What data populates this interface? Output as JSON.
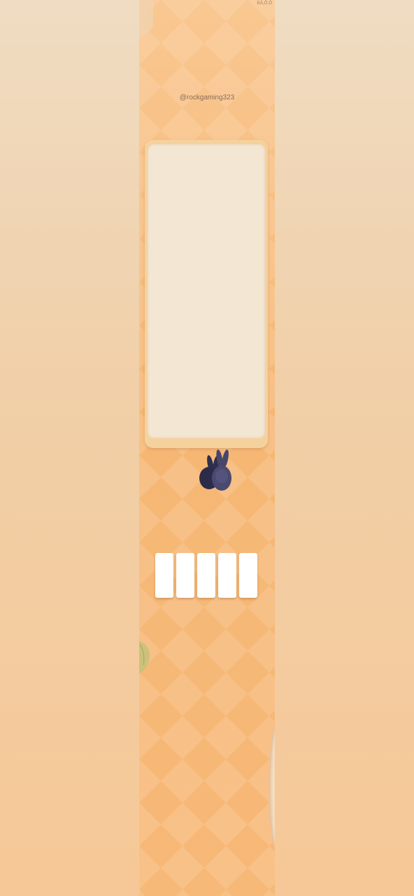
{
  "status_bar": {
    "text": "ĐĂ,Ở,Ô"
  },
  "header": {
    "username": "@rockgaming323"
  },
  "answer_slots": [
    {
      "letter": ""
    },
    {
      "letter": ""
    },
    {
      "letter": ""
    },
    {
      "letter": ""
    },
    {
      "letter": ""
    }
  ],
  "colors": {
    "background": "#f6b774",
    "board": "#f5d29d",
    "board_inner": "#f3e6d3",
    "bunny": "#3b3a5c",
    "slot": "#ffffff"
  },
  "icons": {
    "character": "bunny-icon",
    "decoration": "leaf-icon"
  }
}
